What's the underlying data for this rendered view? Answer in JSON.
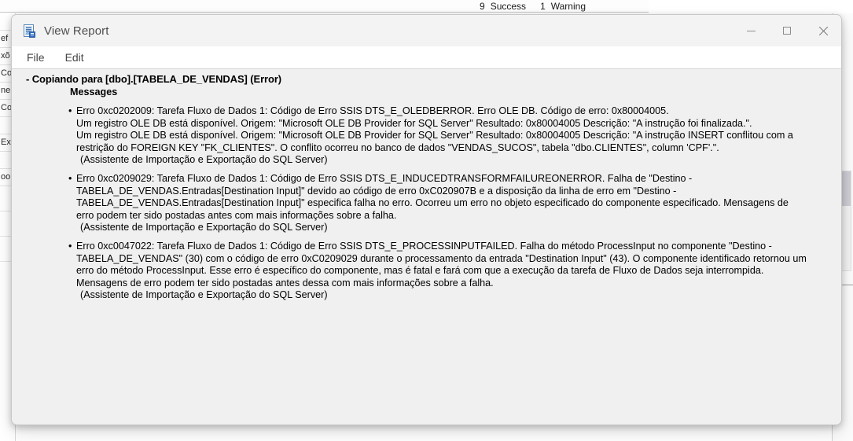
{
  "background": {
    "status": {
      "success_count": "9",
      "success_label": "Success",
      "warning_count": "1",
      "warning_label": "Warning"
    },
    "left_fragments": [
      "",
      "ef",
      "xõ",
      "Cor",
      "ne",
      "Cor",
      "",
      "Ex",
      "",
      "oo",
      "",
      "",
      ""
    ]
  },
  "dialog": {
    "title": "View Report",
    "icon": "report-document-icon",
    "controls": {
      "minimize": "Minimize",
      "maximize": "Maximize",
      "close": "Close"
    },
    "menu": [
      {
        "label": "File"
      },
      {
        "label": "Edit"
      }
    ],
    "report": {
      "heading": "- Copiando para [dbo].[TABELA_DE_VENDAS] (Error)",
      "subheading": "Messages",
      "bullet": "•",
      "messages": [
        {
          "lines": [
            "Erro 0xc0202009: Tarefa Fluxo de Dados 1: Código de Erro SSIS DTS_E_OLEDBERROR.  Erro OLE DB. Código de erro: 0x80004005.",
            "Um registro OLE DB está disponível. Origem: \"Microsoft OLE DB Provider for SQL Server\"  Resultado: 0x80004005  Descrição: \"A instrução foi finalizada.\".",
            "Um registro OLE DB está disponível. Origem: \"Microsoft OLE DB Provider for SQL Server\"  Resultado: 0x80004005  Descrição: \"A instrução INSERT conflitou com a",
            "restrição do FOREIGN KEY \"FK_CLIENTES\". O conflito ocorreu no banco de dados \"VENDAS_SUCOS\", tabela \"dbo.CLIENTES\", column 'CPF'.\"."
          ],
          "source": "(Assistente de Importação e Exportação do SQL Server)"
        },
        {
          "lines": [
            "Erro 0xc0209029: Tarefa Fluxo de Dados 1: Código de Erro SSIS DTS_E_INDUCEDTRANSFORMFAILUREONERROR. Falha de \"Destino -",
            "TABELA_DE_VENDAS.Entradas[Destination Input]\" devido ao código de erro 0xC020907B e a disposição da linha de erro em \"Destino -",
            "TABELA_DE_VENDAS.Entradas[Destination Input]\" especifica falha no erro. Ocorreu um erro no objeto especificado do componente especificado. Mensagens de",
            "erro podem ter sido postadas antes com mais informações sobre a falha."
          ],
          "source": "(Assistente de Importação e Exportação do SQL Server)"
        },
        {
          "lines": [
            "Erro 0xc0047022: Tarefa Fluxo de Dados 1: Código de Erro SSIS DTS_E_PROCESSINPUTFAILED. Falha do método ProcessInput no componente \"Destino -",
            "TABELA_DE_VENDAS\" (30) com o código de erro 0xC0209029 durante o processamento da entrada \"Destination Input\" (43). O componente identificado retornou um",
            "erro do método ProcessInput. Esse erro é específico do componente, mas é fatal e fará com que a execução da tarefa de Fluxo de Dados seja interrompida.",
            "Mensagens de erro podem ter sido postadas antes dessa com mais informações sobre a falha."
          ],
          "source": "(Assistente de Importação e Exportação do SQL Server)"
        }
      ]
    }
  }
}
